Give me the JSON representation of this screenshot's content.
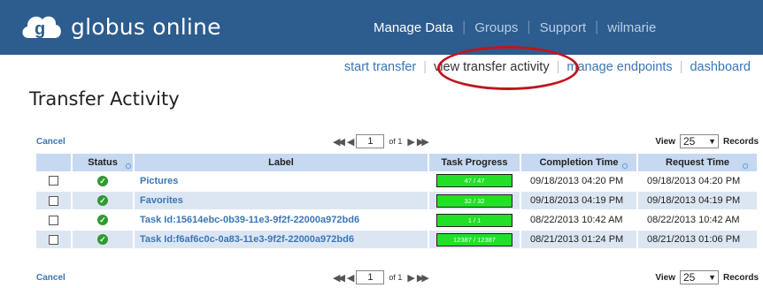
{
  "header": {
    "brand": "globus online",
    "nav": [
      {
        "label": "Manage Data",
        "active": true
      },
      {
        "label": "Groups",
        "active": false
      },
      {
        "label": "Support",
        "active": false
      },
      {
        "label": "wilmarie",
        "active": false
      }
    ]
  },
  "subnav": [
    {
      "label": "start transfer"
    },
    {
      "label": "view transfer activity",
      "current": true
    },
    {
      "label": "manage endpoints"
    },
    {
      "label": "dashboard"
    }
  ],
  "page_title": "Transfer Activity",
  "pager_top": {
    "cancel": "Cancel",
    "page": "1",
    "of": "of 1",
    "view": "View",
    "per_page": "25",
    "records": "Records"
  },
  "pager_bottom": {
    "cancel": "Cancel",
    "page": "1",
    "of": "of 1",
    "view": "View",
    "per_page": "25",
    "records": "Records"
  },
  "table": {
    "columns": [
      "Status",
      "Label",
      "Task Progress",
      "Completion Time",
      "Request Time"
    ],
    "rows": [
      {
        "label": "Pictures",
        "progress": "47 / 47",
        "completion": "09/18/2013 04:20 PM",
        "request": "09/18/2013 04:20 PM"
      },
      {
        "label": "Favorites",
        "progress": "32 / 32",
        "completion": "09/18/2013 04:19 PM",
        "request": "09/18/2013 04:19 PM"
      },
      {
        "label": "Task Id:15614ebc-0b39-11e3-9f2f-22000a972bd6",
        "progress": "1 / 1",
        "completion": "08/22/2013 10:42 AM",
        "request": "08/22/2013 10:42 AM"
      },
      {
        "label": "Task Id:f6af6c0c-0a83-11e3-9f2f-22000a972bd6",
        "progress": "12387 / 12387",
        "completion": "08/21/2013 01:24 PM",
        "request": "08/21/2013 01:06 PM"
      }
    ]
  },
  "colors": {
    "header_bg": "#2d5c8e",
    "table_header_bg": "#c6d9f1",
    "row_alt_bg": "#dce6f3",
    "progress_green": "#22e026",
    "highlight_circle": "#c0161e",
    "link": "#3a76b5"
  }
}
